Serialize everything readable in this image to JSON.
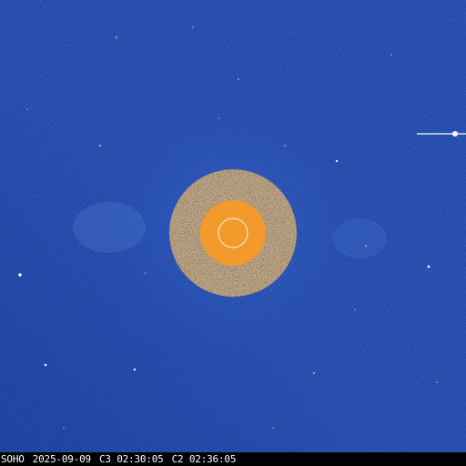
{
  "image": {
    "background_color": "#2147a8",
    "occulter_color": "#f39a2d",
    "disk_outline_color": "#ffffff"
  },
  "caption": {
    "observatory": "SOHO",
    "date": "2025-09-09",
    "c3_time": "C3 02:30:05",
    "c2_time": "C2 02:36:05"
  }
}
